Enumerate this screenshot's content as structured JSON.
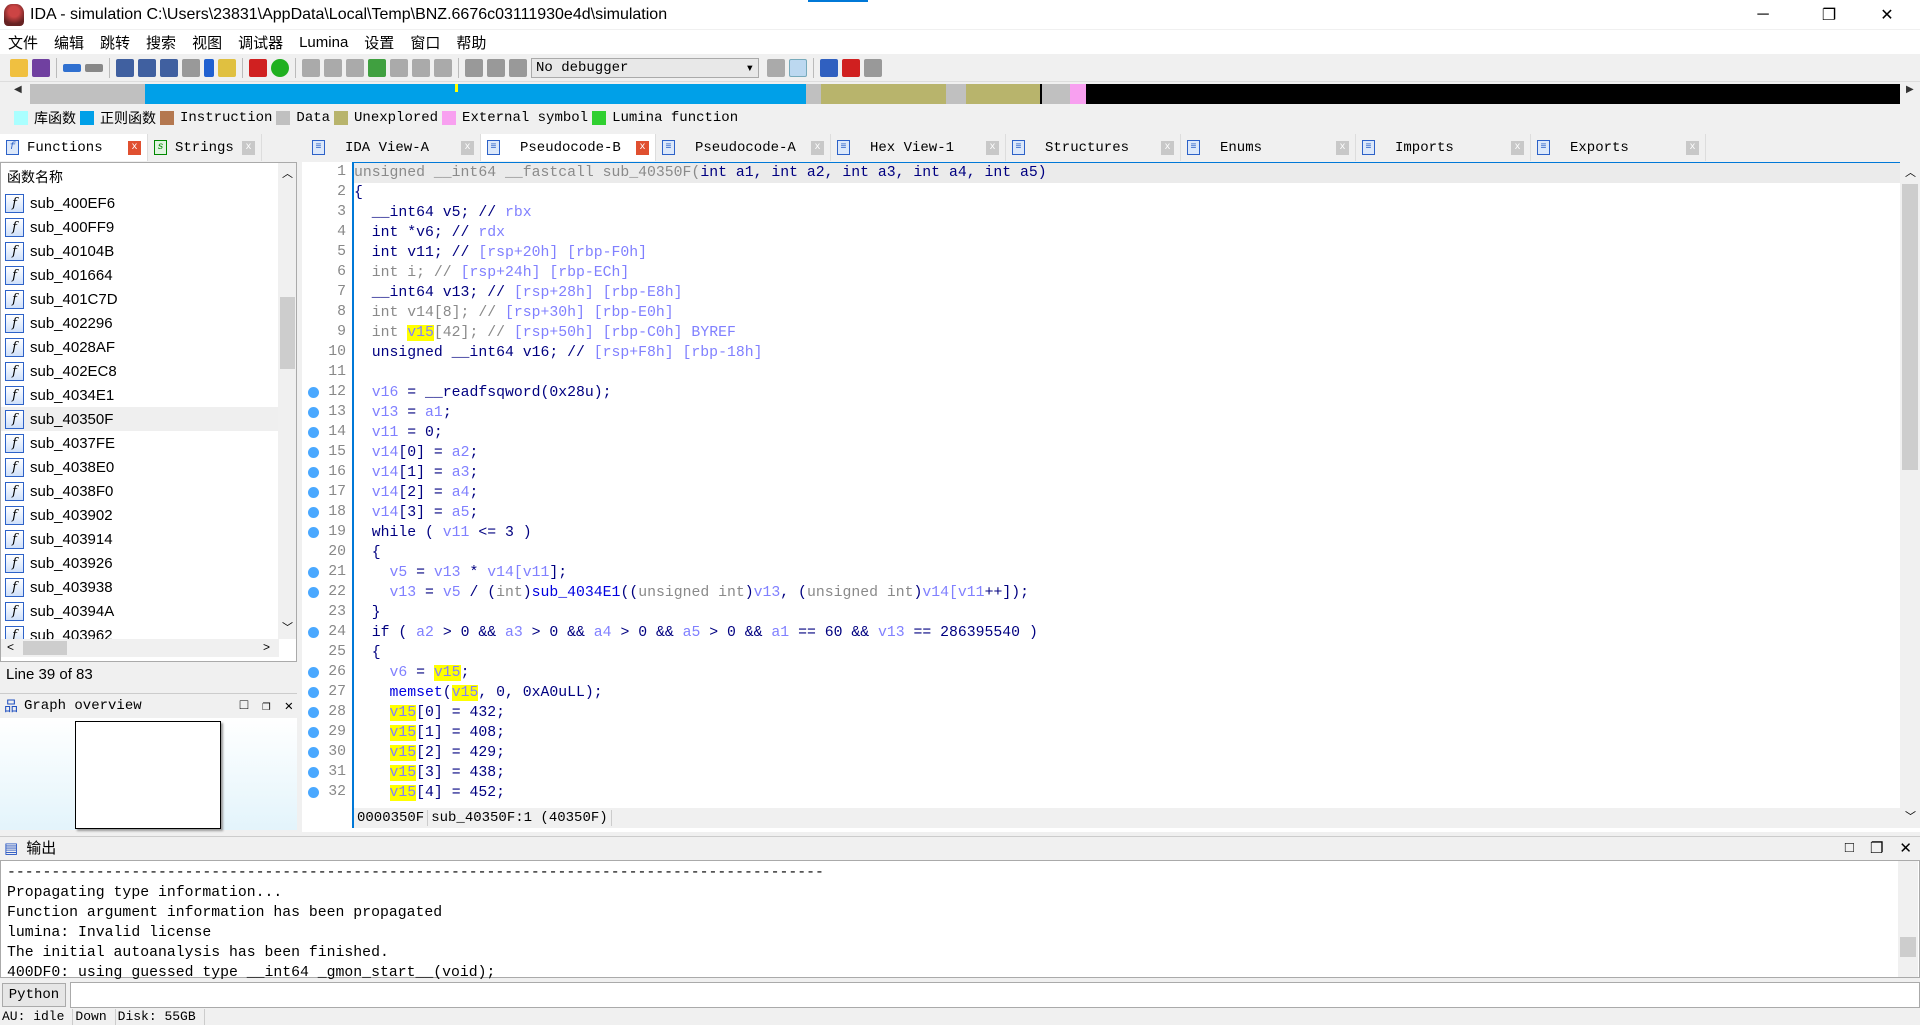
{
  "window": {
    "title": "IDA - simulation C:\\Users\\23831\\AppData\\Local\\Temp\\BNZ.6676c03111930e4d\\simulation",
    "minimize": "─",
    "restore": "❐",
    "close": "✕"
  },
  "menu": [
    "文件",
    "编辑",
    "跳转",
    "搜索",
    "视图",
    "调试器",
    "Lumina",
    "设置",
    "窗口",
    "帮助"
  ],
  "toolbar": {
    "debugger_select": "No debugger"
  },
  "legend": [
    {
      "label": "库函数",
      "color": "#aaffff"
    },
    {
      "label": "正则函数",
      "color": "#00a0e8"
    },
    {
      "label": "Instruction",
      "color": "#b47850"
    },
    {
      "label": "Data",
      "color": "#c0c0c0"
    },
    {
      "label": "Unexplored",
      "color": "#b8b46c"
    },
    {
      "label": "External symbol",
      "color": "#f8a0f0"
    },
    {
      "label": "Lumina function",
      "color": "#30d030"
    }
  ],
  "left_tabs": [
    {
      "label": "Functions",
      "icon": "function-icon",
      "active": true
    },
    {
      "label": "Strings",
      "icon": "strings-icon",
      "active": false
    }
  ],
  "right_tabs": [
    {
      "label": "IDA View-A",
      "active": false
    },
    {
      "label": "Pseudocode-B",
      "active": true
    },
    {
      "label": "Pseudocode-A",
      "active": false
    },
    {
      "label": "Hex View-1",
      "active": false
    },
    {
      "label": "Structures",
      "active": false
    },
    {
      "label": "Enums",
      "active": false
    },
    {
      "label": "Imports",
      "active": false
    },
    {
      "label": "Exports",
      "active": false
    }
  ],
  "functions": {
    "header": "函数名称",
    "selected": "sub_40350F",
    "items": [
      "sub_400EF6",
      "sub_400FF9",
      "sub_40104B",
      "sub_401664",
      "sub_401C7D",
      "sub_402296",
      "sub_4028AF",
      "sub_402EC8",
      "sub_4034E1",
      "sub_40350F",
      "sub_4037FE",
      "sub_4038E0",
      "sub_4038F0",
      "sub_403902",
      "sub_403914",
      "sub_403926",
      "sub_403938",
      "sub_40394A",
      "sub_403962"
    ],
    "line_info": "Line 39 of 83"
  },
  "graph_overview": {
    "title": "Graph overview"
  },
  "code": {
    "lines": [
      {
        "n": "1",
        "dot": false,
        "t": [
          [
            "g",
            "unsigned __int64 __fastcall sub_40350F("
          ],
          [
            "",
            "int a1, int a2, int a3, int a4, int a5)"
          ]
        ]
      },
      {
        "n": "2",
        "dot": false,
        "t": [
          [
            "",
            "{"
          ]
        ]
      },
      {
        "n": "3",
        "dot": false,
        "t": [
          [
            "",
            "  __int64 v5; // "
          ],
          [
            "c",
            "rbx"
          ]
        ]
      },
      {
        "n": "4",
        "dot": false,
        "t": [
          [
            "",
            "  int *v6; // "
          ],
          [
            "c",
            "rdx"
          ]
        ]
      },
      {
        "n": "5",
        "dot": false,
        "t": [
          [
            "",
            "  int v11; // "
          ],
          [
            "c",
            "[rsp+20h] [rbp-F0h]"
          ]
        ]
      },
      {
        "n": "6",
        "dot": false,
        "t": [
          [
            "g",
            "  int i; // "
          ],
          [
            "c",
            "[rsp+24h] [rbp-ECh]"
          ]
        ]
      },
      {
        "n": "7",
        "dot": false,
        "t": [
          [
            "",
            "  __int64 v13; // "
          ],
          [
            "c",
            "[rsp+28h] [rbp-E8h]"
          ]
        ]
      },
      {
        "n": "8",
        "dot": false,
        "t": [
          [
            "g",
            "  int v14[8]; // "
          ],
          [
            "c",
            "[rsp+30h] [rbp-E0h]"
          ]
        ]
      },
      {
        "n": "9",
        "dot": false,
        "t": [
          [
            "g",
            "  int "
          ],
          [
            "h",
            "v15"
          ],
          [
            "g",
            "[42]; // "
          ],
          [
            "c",
            "[rsp+50h] [rbp-C0h] BYREF"
          ]
        ]
      },
      {
        "n": "10",
        "dot": false,
        "t": [
          [
            "",
            "  unsigned __int64 v16; // "
          ],
          [
            "c",
            "[rsp+F8h] [rbp-18h]"
          ]
        ]
      },
      {
        "n": "11",
        "dot": false,
        "t": [
          [
            "",
            ""
          ]
        ]
      },
      {
        "n": "12",
        "dot": true,
        "t": [
          [
            "v",
            "  v16"
          ],
          [
            "",
            " = __readfsqword(0x28u);"
          ]
        ]
      },
      {
        "n": "13",
        "dot": true,
        "t": [
          [
            "v",
            "  v13"
          ],
          [
            "",
            " = "
          ],
          [
            "v",
            "a1"
          ],
          [
            "",
            ";"
          ]
        ]
      },
      {
        "n": "14",
        "dot": true,
        "t": [
          [
            "v",
            "  v11"
          ],
          [
            "",
            " = 0;"
          ]
        ]
      },
      {
        "n": "15",
        "dot": true,
        "t": [
          [
            "v",
            "  v14"
          ],
          [
            "",
            "[0] = "
          ],
          [
            "v",
            "a2"
          ],
          [
            "",
            ";"
          ]
        ]
      },
      {
        "n": "16",
        "dot": true,
        "t": [
          [
            "v",
            "  v14"
          ],
          [
            "",
            "[1] = "
          ],
          [
            "v",
            "a3"
          ],
          [
            "",
            ";"
          ]
        ]
      },
      {
        "n": "17",
        "dot": true,
        "t": [
          [
            "v",
            "  v14"
          ],
          [
            "",
            "[2] = "
          ],
          [
            "v",
            "a4"
          ],
          [
            "",
            ";"
          ]
        ]
      },
      {
        "n": "18",
        "dot": true,
        "t": [
          [
            "v",
            "  v14"
          ],
          [
            "",
            "[3] = "
          ],
          [
            "v",
            "a5"
          ],
          [
            "",
            ";"
          ]
        ]
      },
      {
        "n": "19",
        "dot": true,
        "t": [
          [
            "",
            "  while ( "
          ],
          [
            "v",
            "v11"
          ],
          [
            "",
            " <= 3 )"
          ]
        ]
      },
      {
        "n": "20",
        "dot": false,
        "t": [
          [
            "",
            "  {"
          ]
        ]
      },
      {
        "n": "21",
        "dot": true,
        "t": [
          [
            "v",
            "    v5"
          ],
          [
            "",
            " = "
          ],
          [
            "v",
            "v13"
          ],
          [
            "",
            " * "
          ],
          [
            "v",
            "v14"
          ],
          [
            "v",
            "["
          ],
          [
            "v",
            "v11"
          ],
          [
            "",
            "];"
          ]
        ]
      },
      {
        "n": "22",
        "dot": true,
        "t": [
          [
            "v",
            "    v13"
          ],
          [
            "",
            " = "
          ],
          [
            "v",
            "v5"
          ],
          [
            "",
            " / ("
          ],
          [
            "g",
            "int"
          ],
          [
            "",
            ")"
          ],
          [
            "f",
            "sub_4034E1"
          ],
          [
            "",
            "(("
          ],
          [
            "g",
            "unsigned int"
          ],
          [
            "",
            ")"
          ],
          [
            "v",
            "v13"
          ],
          [
            "",
            ", ("
          ],
          [
            "g",
            "unsigned int"
          ],
          [
            "",
            ")"
          ],
          [
            "v",
            "v14"
          ],
          [
            "v",
            "["
          ],
          [
            "v",
            "v11"
          ],
          [
            "",
            "++]);"
          ]
        ]
      },
      {
        "n": "23",
        "dot": false,
        "t": [
          [
            "",
            "  }"
          ]
        ]
      },
      {
        "n": "24",
        "dot": true,
        "t": [
          [
            "",
            "  if ( "
          ],
          [
            "v",
            "a2"
          ],
          [
            "",
            " > 0 && "
          ],
          [
            "v",
            "a3"
          ],
          [
            "",
            " > 0 && "
          ],
          [
            "v",
            "a4"
          ],
          [
            "",
            " > 0 && "
          ],
          [
            "v",
            "a5"
          ],
          [
            "",
            " > 0 && "
          ],
          [
            "v",
            "a1"
          ],
          [
            "",
            " == 60 && "
          ],
          [
            "v",
            "v13"
          ],
          [
            "",
            " == 286395540 )"
          ]
        ]
      },
      {
        "n": "25",
        "dot": false,
        "t": [
          [
            "",
            "  {"
          ]
        ]
      },
      {
        "n": "26",
        "dot": true,
        "t": [
          [
            "v",
            "    v6"
          ],
          [
            "",
            " = "
          ],
          [
            "h",
            "v15"
          ],
          [
            "",
            ";"
          ]
        ]
      },
      {
        "n": "27",
        "dot": true,
        "t": [
          [
            "f",
            "    memset"
          ],
          [
            "",
            "("
          ],
          [
            "h",
            "v15"
          ],
          [
            "",
            ", 0, 0xA0uLL);"
          ]
        ]
      },
      {
        "n": "28",
        "dot": true,
        "t": [
          [
            "",
            "    "
          ],
          [
            "h",
            "v15"
          ],
          [
            "",
            "[0] = 432;"
          ]
        ]
      },
      {
        "n": "29",
        "dot": true,
        "t": [
          [
            "",
            "    "
          ],
          [
            "h",
            "v15"
          ],
          [
            "",
            "[1] = 408;"
          ]
        ]
      },
      {
        "n": "30",
        "dot": true,
        "t": [
          [
            "",
            "    "
          ],
          [
            "h",
            "v15"
          ],
          [
            "",
            "[2] = 429;"
          ]
        ]
      },
      {
        "n": "31",
        "dot": true,
        "t": [
          [
            "",
            "    "
          ],
          [
            "h",
            "v15"
          ],
          [
            "",
            "[3] = 438;"
          ]
        ]
      },
      {
        "n": "32",
        "dot": true,
        "t": [
          [
            "",
            "    "
          ],
          [
            "h",
            "v15"
          ],
          [
            "",
            "[4] = 452;"
          ]
        ]
      }
    ],
    "status": {
      "offset": "0000350F",
      "location": "sub_40350F:1 (40350F)"
    }
  },
  "output": {
    "title": "输出",
    "lines": [
      "--------------------------------------------------------------------------------------------",
      "Propagating type information...",
      "Function argument information has been propagated",
      "lumina: Invalid license",
      "The initial autoanalysis has been finished.",
      "400DF0: using guessed type __int64 _gmon_start__(void);"
    ]
  },
  "python": {
    "label": "Python"
  },
  "status": {
    "au": "AU:  idle",
    "down": "Down",
    "disk": "Disk: 55GB"
  }
}
